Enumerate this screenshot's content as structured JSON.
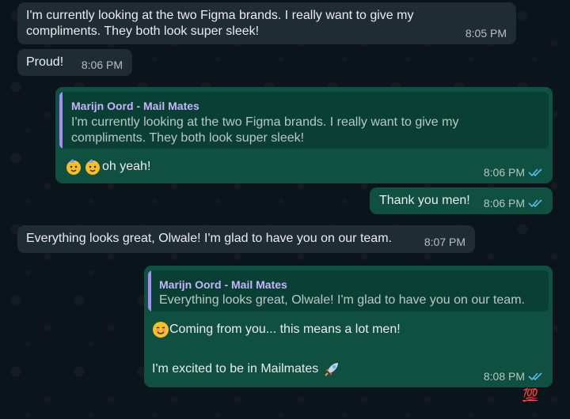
{
  "messages": [
    {
      "text": "I'm currently looking at the two Figma brands. I really want to give my compliments. They both look super sleek!",
      "time": "8:05 PM"
    },
    {
      "text": "Proud!",
      "time": "8:06 PM"
    },
    {
      "quote_author": "Marijn Oord - Mail Mates",
      "quote_text": "I'm currently looking at the two Figma brands. I really want to give my compliments. They both look super sleek!",
      "text": "oh yeah!",
      "emojis": [
        "party-face-icon",
        "party-face-icon"
      ],
      "time": "8:06 PM",
      "status": "read"
    },
    {
      "text": "Thank you men!",
      "time": "8:06 PM",
      "status": "read"
    },
    {
      "text": "Everything looks great, Olwale! I'm glad to have you on our team.",
      "time": "8:07 PM"
    },
    {
      "quote_author": "Marijn Oord - Mail Mates",
      "quote_text": "Everything looks great, Olwale! I'm glad to have you on our team.",
      "line1": "Coming from you... this means a lot men!",
      "line2": "I'm excited to be in Mailmates",
      "emojis": [
        "smiling-face-icon",
        "rocket-icon"
      ],
      "time": "8:08 PM",
      "status": "read",
      "reaction": "💯"
    }
  ],
  "colors": {
    "incoming": "#202c33",
    "outgoing": "#0f5040",
    "quote_bar": "#a78bfa",
    "read_ticks": "#53bdeb"
  }
}
